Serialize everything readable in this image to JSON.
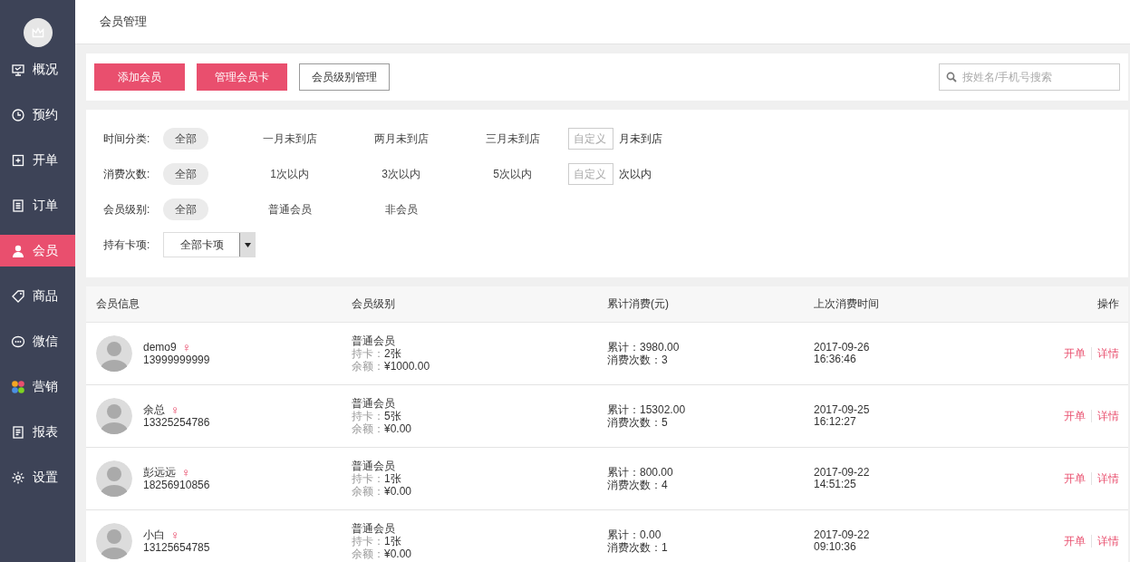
{
  "sidebar": {
    "items": [
      {
        "label": "概况",
        "selected": false
      },
      {
        "label": "预约",
        "selected": false
      },
      {
        "label": "开单",
        "selected": false
      },
      {
        "label": "订单",
        "selected": false
      },
      {
        "label": "会员",
        "selected": true
      },
      {
        "label": "商品",
        "selected": false
      },
      {
        "label": "微信",
        "selected": false
      },
      {
        "label": "营销",
        "selected": false
      },
      {
        "label": "报表",
        "selected": false
      },
      {
        "label": "设置",
        "selected": false
      }
    ]
  },
  "page_title": "会员管理",
  "toolbar": {
    "buttons": [
      {
        "label": "添加会员",
        "kind": "primary"
      },
      {
        "label": "管理会员卡",
        "kind": "primary"
      },
      {
        "label": "会员级别管理",
        "kind": "outline"
      }
    ],
    "search": {
      "placeholder": "按姓名/手机号搜索"
    }
  },
  "filters": [
    {
      "label": "时间分类:",
      "kind": "options",
      "options": [
        {
          "label": "全部",
          "selected": true
        },
        {
          "label": "一月未到店",
          "selected": false
        },
        {
          "label": "两月未到店",
          "selected": false
        },
        {
          "label": "三月未到店",
          "selected": false
        }
      ],
      "custom": {
        "placeholder": "自定义",
        "suffix": "月未到店"
      }
    },
    {
      "label": "消费次数:",
      "kind": "options",
      "options": [
        {
          "label": "全部",
          "selected": true
        },
        {
          "label": "1次以内",
          "selected": false
        },
        {
          "label": "3次以内",
          "selected": false
        },
        {
          "label": "5次以内",
          "selected": false
        }
      ],
      "custom": {
        "placeholder": "自定义",
        "suffix": "次以内"
      }
    },
    {
      "label": "会员级别:",
      "kind": "options",
      "options": [
        {
          "label": "全部",
          "selected": true
        },
        {
          "label": "普通会员",
          "selected": false
        },
        {
          "label": "非会员",
          "selected": false
        }
      ]
    },
    {
      "label": "持有卡项:",
      "kind": "select",
      "value": "全部卡项"
    }
  ],
  "table": {
    "columns": [
      "会员信息",
      "会员级别",
      "累计消费(元)",
      "上次消费时间",
      "操作"
    ],
    "rows": [
      {
        "name": "demo9",
        "gender": "♀",
        "phone": "13999999999",
        "level": "普通会员",
        "cards_label": "持卡：",
        "cards": "2张",
        "balance_label": "余额：",
        "balance": "¥1000.00",
        "total": "累计：3980.00",
        "count": "消费次数：3",
        "date": "2017-09-26",
        "time": "16:36:46",
        "actions": [
          "开单",
          "详情"
        ]
      },
      {
        "name": "余总",
        "gender": "♀",
        "phone": "13325254786",
        "level": "普通会员",
        "cards_label": "持卡：",
        "cards": "5张",
        "balance_label": "余额：",
        "balance": "¥0.00",
        "total": "累计：15302.00",
        "count": "消费次数：5",
        "date": "2017-09-25",
        "time": "16:12:27",
        "actions": [
          "开单",
          "详情"
        ]
      },
      {
        "name": "彭远远",
        "gender": "♀",
        "phone": "18256910856",
        "level": "普通会员",
        "cards_label": "持卡：",
        "cards": "1张",
        "balance_label": "余额：",
        "balance": "¥0.00",
        "total": "累计：800.00",
        "count": "消费次数：4",
        "date": "2017-09-22",
        "time": "14:51:25",
        "actions": [
          "开单",
          "详情"
        ]
      },
      {
        "name": "小白",
        "gender": "♀",
        "phone": "13125654785",
        "level": "普通会员",
        "cards_label": "持卡：",
        "cards": "1张",
        "balance_label": "余额：",
        "balance": "¥0.00",
        "total": "累计：0.00",
        "count": "消费次数：1",
        "date": "2017-09-22",
        "time": "09:10:36",
        "actions": [
          "开单",
          "详情"
        ]
      }
    ]
  }
}
